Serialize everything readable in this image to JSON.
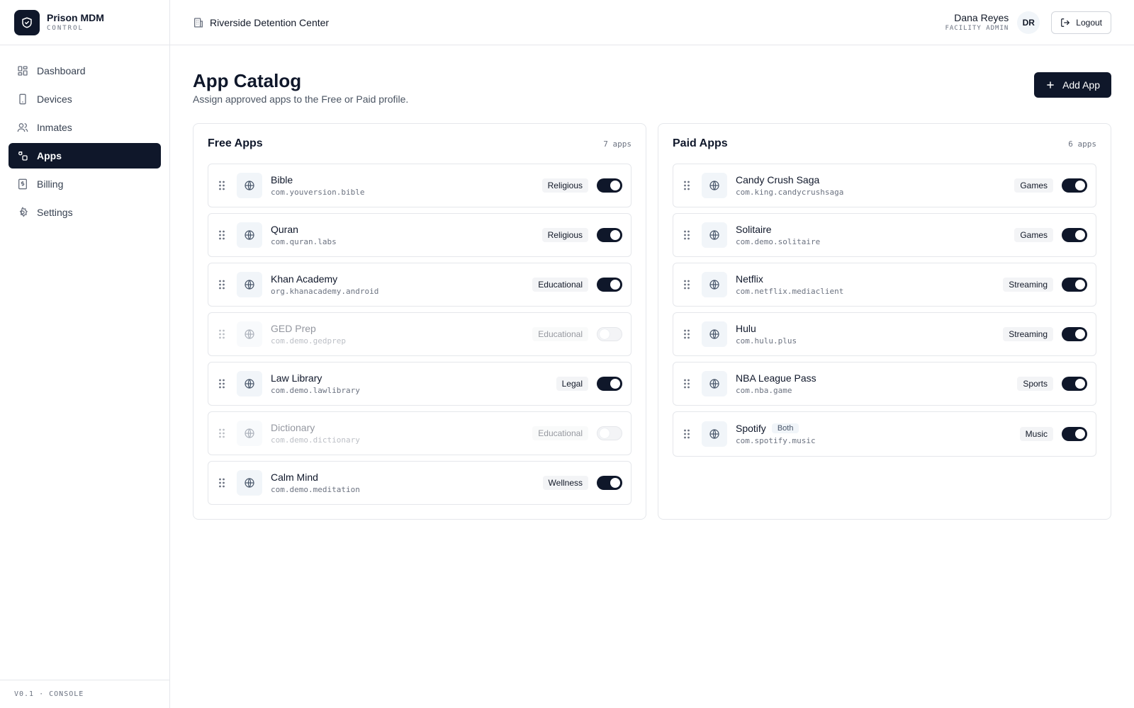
{
  "brand": {
    "name": "Prison MDM",
    "subtitle": "CONTROL"
  },
  "nav": [
    {
      "label": "Dashboard",
      "icon": "dashboard-icon",
      "active": false
    },
    {
      "label": "Devices",
      "icon": "device-icon",
      "active": false
    },
    {
      "label": "Inmates",
      "icon": "users-icon",
      "active": false
    },
    {
      "label": "Apps",
      "icon": "apps-icon",
      "active": true
    },
    {
      "label": "Billing",
      "icon": "billing-icon",
      "active": false
    },
    {
      "label": "Settings",
      "icon": "gear-icon",
      "active": false
    }
  ],
  "footer": "V0.1 · CONSOLE",
  "topbar": {
    "facility": "Riverside Detention Center",
    "user_name": "Dana Reyes",
    "user_role": "FACILITY ADMIN",
    "avatar_initials": "DR",
    "logout_label": "Logout"
  },
  "page": {
    "title": "App Catalog",
    "subtitle": "Assign approved apps to the Free or Paid profile.",
    "add_button": "Add App"
  },
  "colors": {
    "primary": "#0f172a",
    "border": "#e5e7eb",
    "badge_bg": "#f3f4f6"
  },
  "free": {
    "title": "Free Apps",
    "count": "7 apps",
    "apps": [
      {
        "name": "Bible",
        "package": "com.youversion.bible",
        "category": "Religious",
        "enabled": true
      },
      {
        "name": "Quran",
        "package": "com.quran.labs",
        "category": "Religious",
        "enabled": true
      },
      {
        "name": "Khan Academy",
        "package": "org.khanacademy.android",
        "category": "Educational",
        "enabled": true
      },
      {
        "name": "GED Prep",
        "package": "com.demo.gedprep",
        "category": "Educational",
        "enabled": false
      },
      {
        "name": "Law Library",
        "package": "com.demo.lawlibrary",
        "category": "Legal",
        "enabled": true
      },
      {
        "name": "Dictionary",
        "package": "com.demo.dictionary",
        "category": "Educational",
        "enabled": false
      },
      {
        "name": "Calm Mind",
        "package": "com.demo.meditation",
        "category": "Wellness",
        "enabled": true
      }
    ]
  },
  "paid": {
    "title": "Paid Apps",
    "count": "6 apps",
    "apps": [
      {
        "name": "Candy Crush Saga",
        "package": "com.king.candycrushsaga",
        "category": "Games",
        "enabled": true
      },
      {
        "name": "Solitaire",
        "package": "com.demo.solitaire",
        "category": "Games",
        "enabled": true
      },
      {
        "name": "Netflix",
        "package": "com.netflix.mediaclient",
        "category": "Streaming",
        "enabled": true
      },
      {
        "name": "Hulu",
        "package": "com.hulu.plus",
        "category": "Streaming",
        "enabled": true
      },
      {
        "name": "NBA League Pass",
        "package": "com.nba.game",
        "category": "Sports",
        "enabled": true
      },
      {
        "name": "Spotify",
        "package": "com.spotify.music",
        "category": "Music",
        "enabled": true,
        "badge": "Both"
      }
    ]
  }
}
